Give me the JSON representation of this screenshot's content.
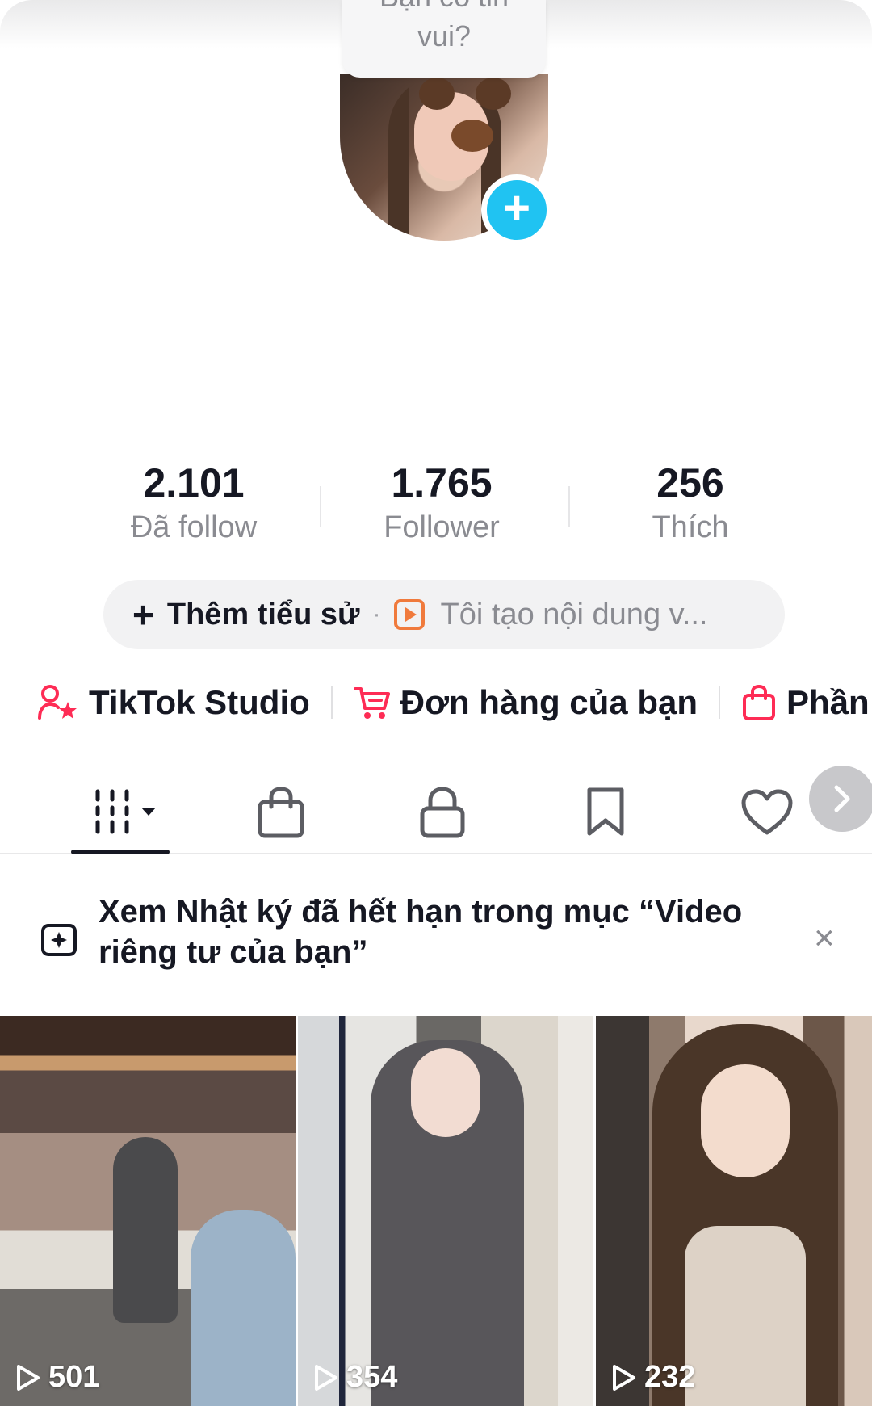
{
  "tooltip": {
    "partial_text": "Bạn có tin",
    "text": "vui?"
  },
  "stats": [
    {
      "value": "2.101",
      "label": "Đã follow"
    },
    {
      "value": "1.765",
      "label": "Follower"
    },
    {
      "value": "256",
      "label": "Thích"
    }
  ],
  "bio": {
    "add_label": "Thêm tiểu sử",
    "separator": "·",
    "description": "Tôi tạo nội dung v..."
  },
  "links": [
    {
      "label": "TikTok Studio",
      "icon": "user-star-icon"
    },
    {
      "label": "Đơn hàng của bạn",
      "icon": "cart-icon"
    },
    {
      "label": "Phần",
      "icon": "bag-icon"
    }
  ],
  "tabs": [
    {
      "icon": "videos-grid-icon",
      "active": true
    },
    {
      "icon": "shopping-bag-icon"
    },
    {
      "icon": "lock-icon"
    },
    {
      "icon": "bookmark-icon"
    },
    {
      "icon": "heart-icon"
    }
  ],
  "notice": {
    "text": "Xem Nhật ký đã hết hạn trong mục “Video riêng tư của bạn”",
    "close": "×"
  },
  "videos": [
    {
      "views": "501"
    },
    {
      "views": "354"
    },
    {
      "views": "232"
    }
  ],
  "colors": {
    "accent_pink": "#fe2c55",
    "add_button": "#20c3f2",
    "video_icon": "#f07a3c"
  }
}
